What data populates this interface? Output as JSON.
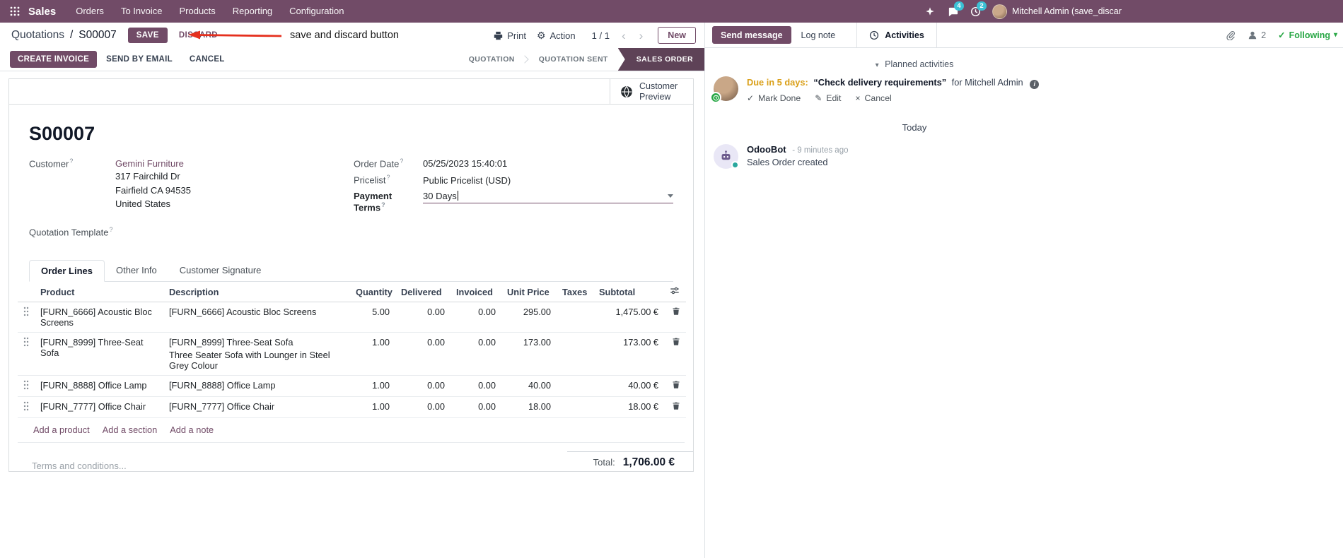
{
  "colors": {
    "primary": "#714B67",
    "statusbar_active": "#5e4257",
    "badge_teal": "#3bc0d4",
    "due_amber": "#daa019",
    "success_green": "#28a745",
    "value_blue": "#2a7bd4",
    "annotation_red": "#e5301e",
    "link": "#714B67"
  },
  "icons": {
    "gear": "⚙",
    "chevron_left": "‹",
    "chevron_right": "›",
    "caret_down": "▾",
    "check": "✓",
    "pencil": "✎",
    "cross": "×",
    "info": "i"
  },
  "navbar": {
    "brand": "Sales",
    "menus": [
      "Orders",
      "To Invoice",
      "Products",
      "Reporting",
      "Configuration"
    ],
    "badges": {
      "messages": "4",
      "activities": "2"
    },
    "user_name": "Mitchell Admin (save_discar"
  },
  "control_panel": {
    "breadcrumb_parent": "Quotations",
    "breadcrumb_separator": "/",
    "breadcrumb_current": "S00007",
    "save_label": "SAVE",
    "discard_label": "DISCARD",
    "annotation_text": "save and discard button",
    "print_label": "Print",
    "action_label": "Action",
    "pager_value": "1 / 1",
    "new_label": "New"
  },
  "statusbar": {
    "buttons": [
      "CREATE INVOICE",
      "SEND BY EMAIL",
      "CANCEL"
    ],
    "steps": [
      {
        "label": "QUOTATION",
        "active": false
      },
      {
        "label": "QUOTATION SENT",
        "active": false
      },
      {
        "label": "SALES ORDER",
        "active": true
      }
    ]
  },
  "form": {
    "help_marker": "?",
    "customer_preview_label": "Customer Preview",
    "title": "S00007",
    "customer_label": "Customer",
    "customer_name": "Gemini Furniture",
    "customer_address": [
      "317 Fairchild Dr",
      "Fairfield CA 94535",
      "United States"
    ],
    "quotation_template_label": "Quotation Template",
    "order_date_label": "Order Date",
    "order_date_value": "05/25/2023 15:40:01",
    "pricelist_label": "Pricelist",
    "pricelist_value": "Public Pricelist (USD)",
    "payment_terms_label": "Payment Terms",
    "payment_terms_value": "30 Days",
    "tabs": [
      "Order Lines",
      "Other Info",
      "Customer Signature"
    ],
    "order_lines": {
      "columns": [
        "Product",
        "Description",
        "Quantity",
        "Delivered",
        "Invoiced",
        "Unit Price",
        "Taxes",
        "Subtotal"
      ],
      "rows": [
        {
          "product": "[FURN_6666] Acoustic Bloc Screens",
          "description": "[FURN_6666] Acoustic Bloc Screens",
          "description2": "",
          "quantity": "5.00",
          "delivered": "0.00",
          "invoiced": "0.00",
          "unit_price": "295.00",
          "taxes": "",
          "subtotal": "1,475.00 €"
        },
        {
          "product": "[FURN_8999] Three-Seat Sofa",
          "description": "[FURN_8999] Three-Seat Sofa",
          "description2": "Three Seater Sofa with Lounger in Steel Grey Colour",
          "quantity": "1.00",
          "delivered": "0.00",
          "invoiced": "0.00",
          "unit_price": "173.00",
          "taxes": "",
          "subtotal": "173.00 €"
        },
        {
          "product": "[FURN_8888] Office Lamp",
          "description": "[FURN_8888] Office Lamp",
          "description2": "",
          "quantity": "1.00",
          "delivered": "0.00",
          "invoiced": "0.00",
          "unit_price": "40.00",
          "taxes": "",
          "subtotal": "40.00 €"
        },
        {
          "product": "[FURN_7777] Office Chair",
          "description": "[FURN_7777] Office Chair",
          "description2": "",
          "quantity": "1.00",
          "delivered": "0.00",
          "invoiced": "0.00",
          "unit_price": "18.00",
          "taxes": "",
          "subtotal": "18.00 €"
        }
      ],
      "add_links": [
        "Add a product",
        "Add a section",
        "Add a note"
      ]
    },
    "terms_placeholder": "Terms and conditions...",
    "total_label": "Total:",
    "total_value": "1,706.00 €"
  },
  "chatter": {
    "send_message_label": "Send message",
    "log_note_label": "Log note",
    "activities_label": "Activities",
    "followers_count": "2",
    "following_label": "Following",
    "planned_header": "Planned activities",
    "activity": {
      "due": "Due in 5 days:",
      "summary": "“Check delivery requirements”",
      "assignee": "for Mitchell Admin",
      "mark_done": "Mark Done",
      "edit": "Edit",
      "cancel": "Cancel"
    },
    "date_divider": "Today",
    "message": {
      "author": "OdooBot",
      "time": "- 9 minutes ago",
      "body": "Sales Order created"
    }
  }
}
